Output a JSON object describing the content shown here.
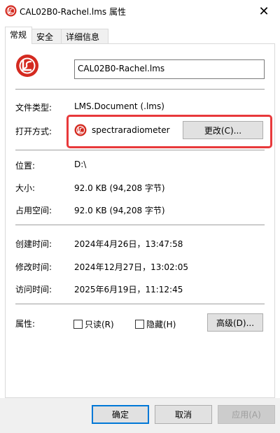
{
  "window": {
    "title": "CAL02B0-Rachel.lms 属性",
    "close_glyph": "✕"
  },
  "tabs": [
    {
      "label": "常规",
      "active": true
    },
    {
      "label": "安全",
      "active": false
    },
    {
      "label": "详细信息",
      "active": false
    }
  ],
  "general": {
    "file_name": "CAL02B0-Rachel.lms",
    "file_type_label": "文件类型:",
    "file_type_value": "LMS.Document (.lms)",
    "opens_with_label": "打开方式:",
    "opens_with_value": "spectraradiometer",
    "change_button": "更改(C)...",
    "location_label": "位置:",
    "location_value": "D:\\",
    "size_label": "大小:",
    "size_value": "92.0 KB (94,208 字节)",
    "size_on_disk_label": "占用空间:",
    "size_on_disk_value": "92.0 KB (94,208 字节)",
    "created_label": "创建时间:",
    "created_value": "2024年4月26日，13:47:58",
    "modified_label": "修改时间:",
    "modified_value": "2024年12月27日，13:02:05",
    "accessed_label": "访问时间:",
    "accessed_value": "2025年6月19日，11:12:45",
    "attributes_label": "属性:",
    "readonly_label": "只读(R)",
    "readonly_checked": false,
    "hidden_label": "隐藏(H)",
    "hidden_checked": false,
    "advanced_button": "高级(D)..."
  },
  "footer": {
    "ok": "确定",
    "cancel": "取消",
    "apply": "应用(A)"
  },
  "colors": {
    "icon_red": "#d42a20",
    "highlight": "#e8393b",
    "accent": "#0078d7"
  },
  "icons": {
    "app_icon": "lms-app-icon",
    "close": "close-icon"
  }
}
